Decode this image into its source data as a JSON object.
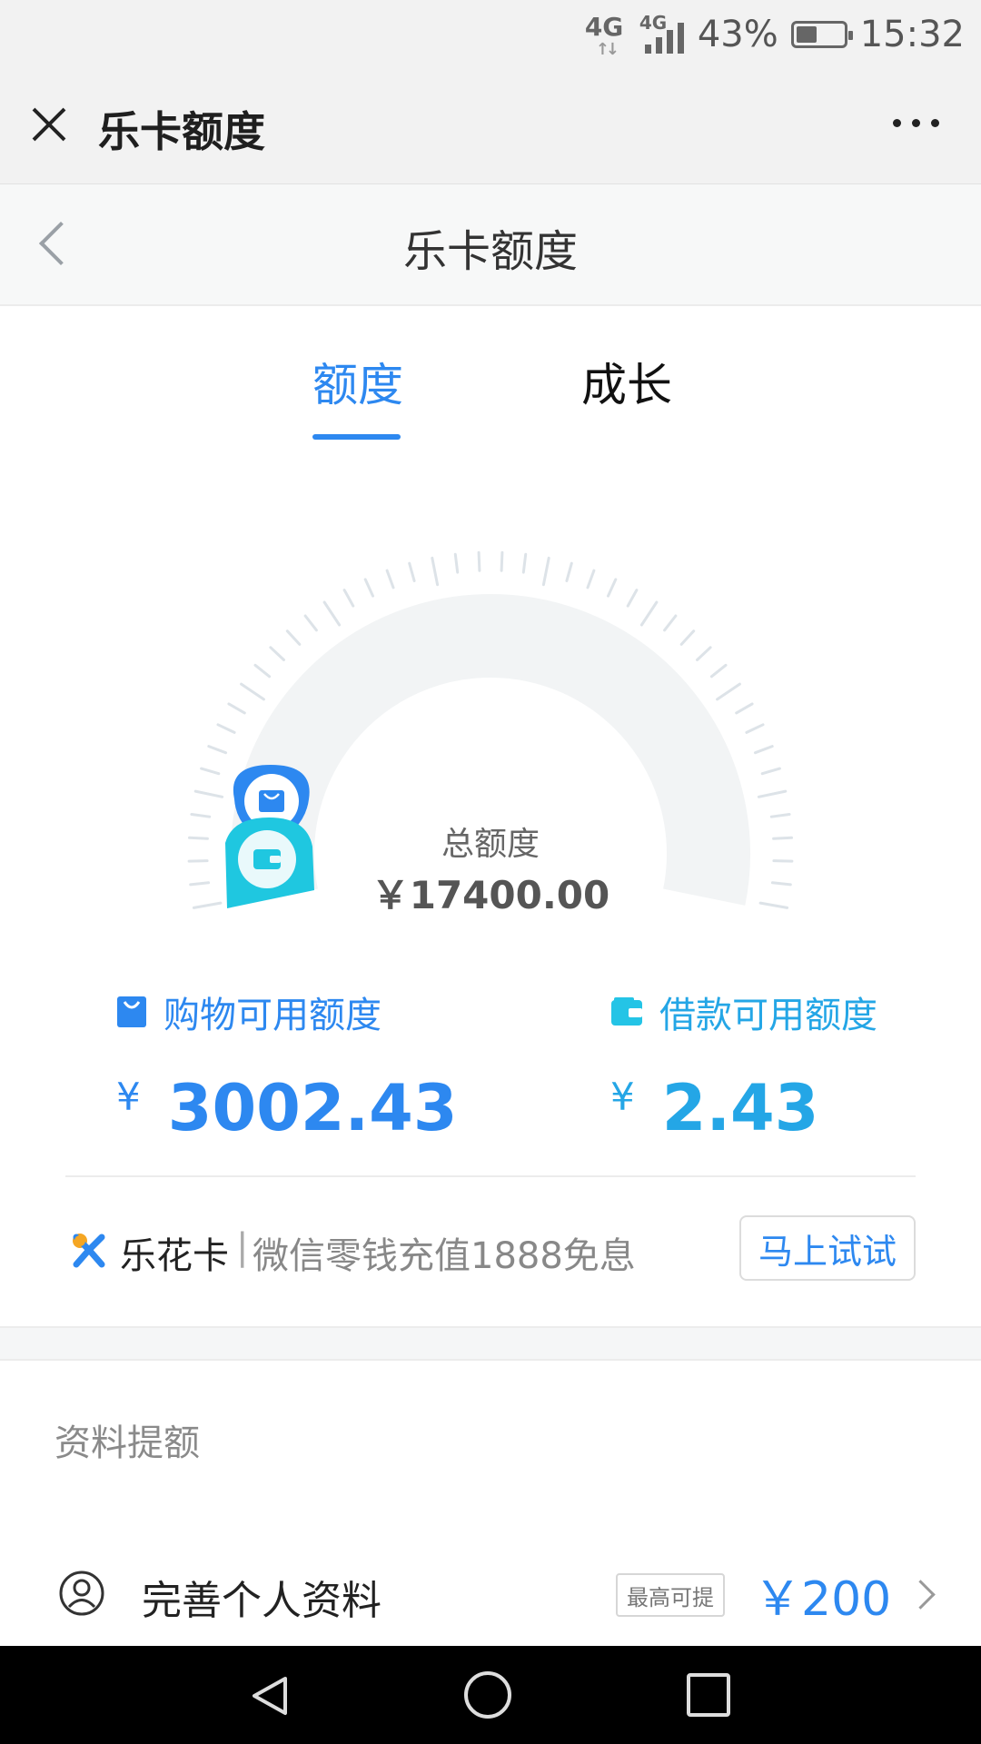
{
  "status_bar": {
    "network1": "4G",
    "network2": "4G",
    "battery_percent": "43%",
    "battery_level": 0.43,
    "time": "15:32"
  },
  "wechat_bar": {
    "title": "乐卡额度"
  },
  "page_header": {
    "title": "乐卡额度"
  },
  "tabs": [
    {
      "label": "额度",
      "active": true
    },
    {
      "label": "成长",
      "active": false
    }
  ],
  "gauge": {
    "total_label": "总额度",
    "total_value": "￥17400.00",
    "total_amount": 17400,
    "used_fraction": 0.0
  },
  "shopping": {
    "label": "购物可用额度",
    "currency": "¥",
    "value": "3002.43"
  },
  "loan": {
    "label": "借款可用额度",
    "currency": "¥",
    "value": "2.43"
  },
  "promo": {
    "name": "乐花卡",
    "separator": "|",
    "text": "微信零钱充值1888免息",
    "button_label": "马上试试"
  },
  "section": {
    "title": "资料提额"
  },
  "profile_row": {
    "label": "完善个人资料",
    "badge": "最高可提",
    "value": "￥200"
  },
  "colors": {
    "accent_blue": "#2d88f0",
    "accent_cyan": "#24a6e6",
    "gauge_track": "#f2f4f5",
    "tick": "#dde3e8"
  }
}
